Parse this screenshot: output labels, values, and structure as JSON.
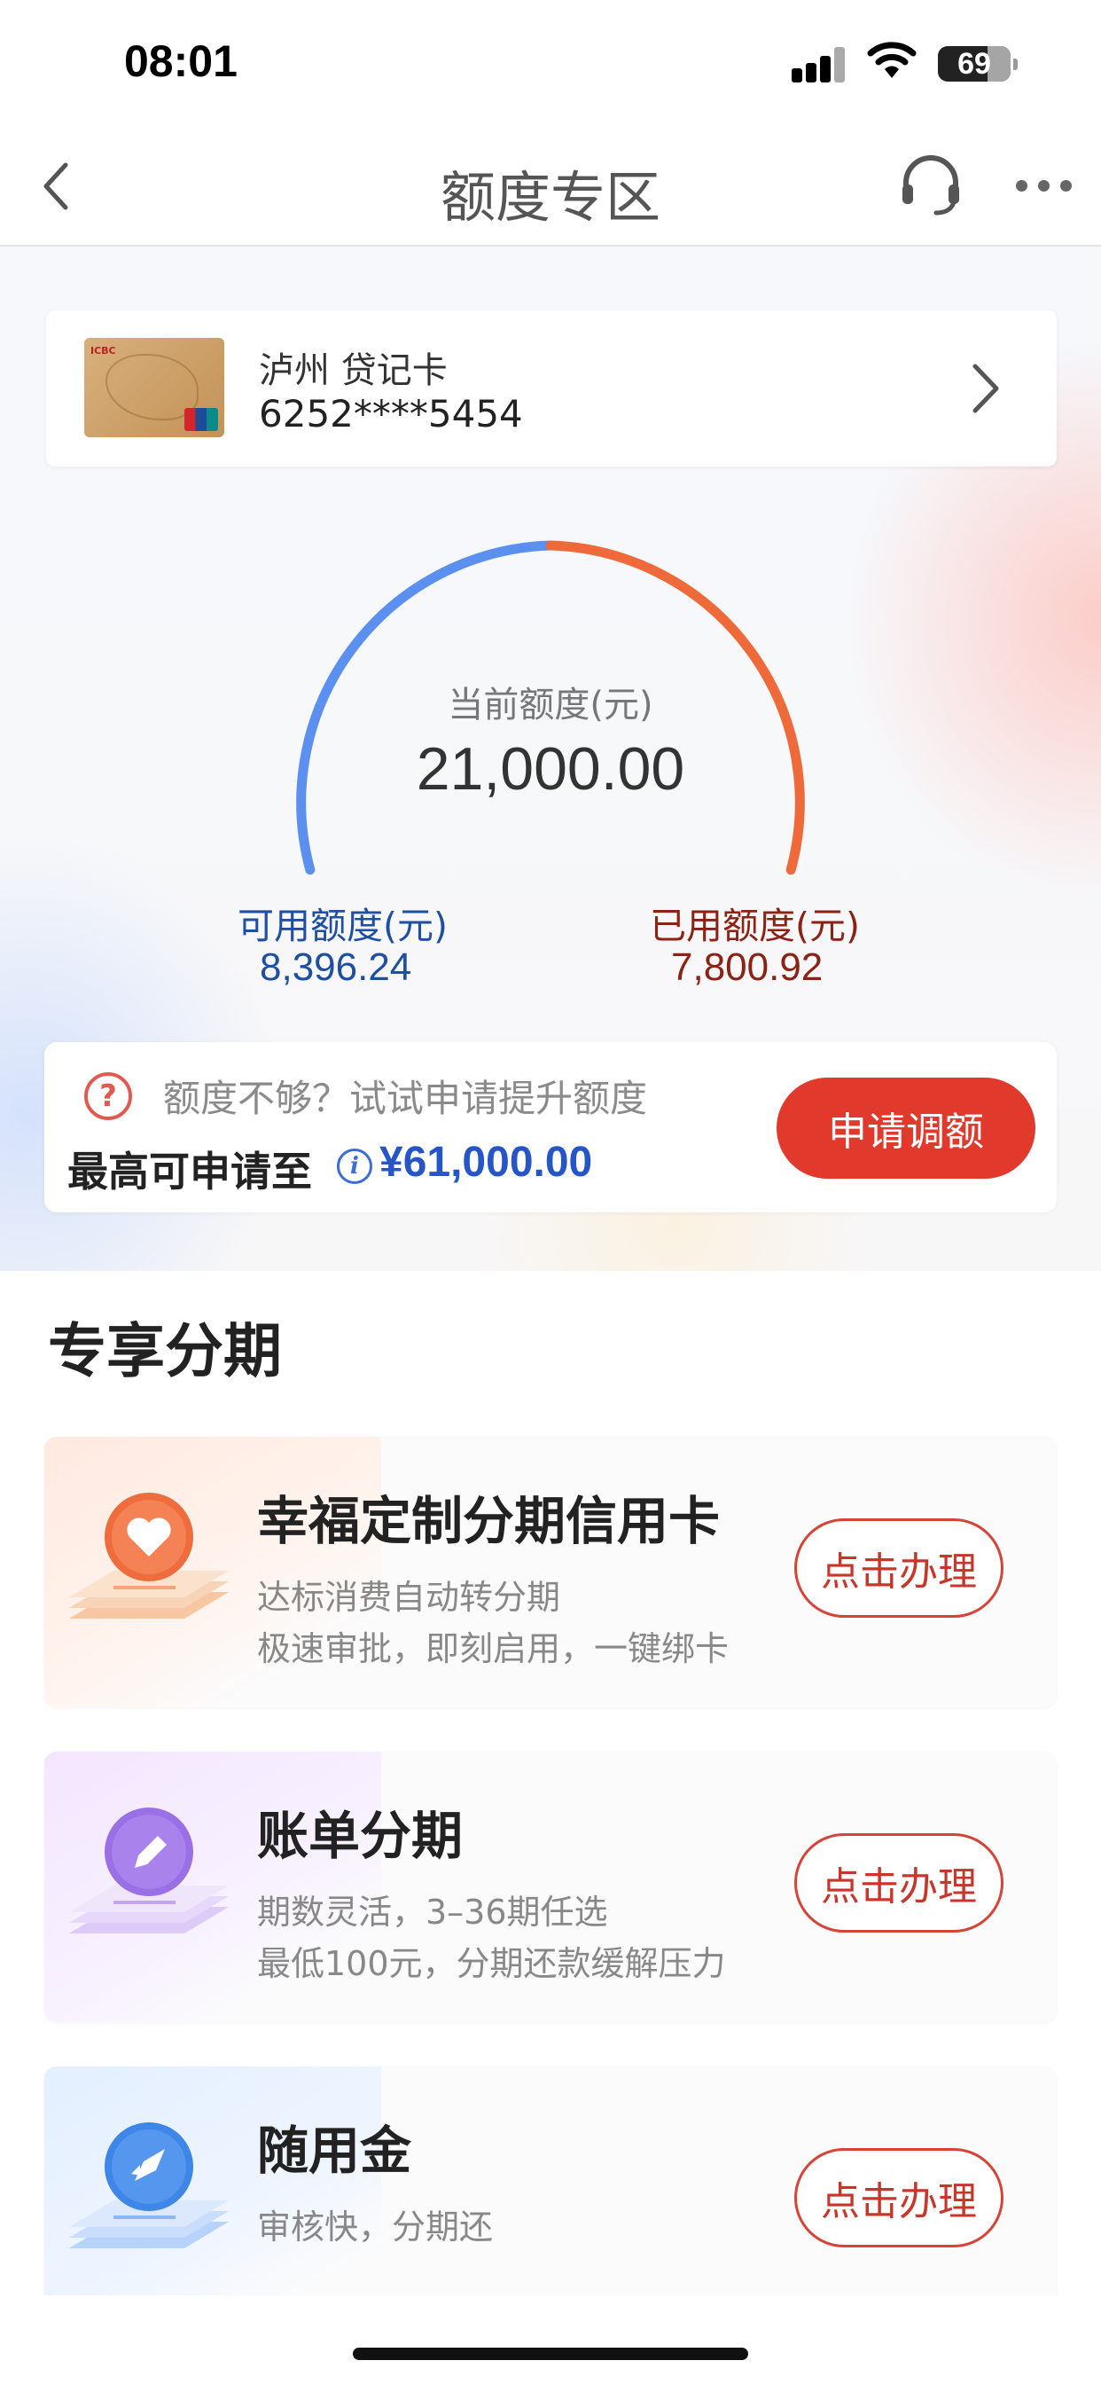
{
  "status_bar": {
    "time": "08:01",
    "battery": "69"
  },
  "nav": {
    "title": "额度专区",
    "icons": [
      "chevron-left-icon",
      "headset-icon",
      "more-icon"
    ]
  },
  "card": {
    "name": "泸州 贷记卡",
    "number": "6252****5454"
  },
  "limit_gauge": {
    "caption": "当前额度(元)",
    "current": "21,000.00",
    "available_label": "可用额度(元)",
    "available_value": "8,396.24",
    "used_label": "已用额度(元)",
    "used_value": "7,800.92",
    "colors": {
      "available": "#5b8ff0",
      "used": "#ee6a3a"
    }
  },
  "limit_upgrade": {
    "tip": "额度不够？试试申请提升额度",
    "label": "最高可申请至",
    "amount": "¥61,000.00",
    "button": "申请调额"
  },
  "section": {
    "title": "专享分期"
  },
  "products": [
    {
      "title": "幸福定制分期信用卡",
      "line1": "达标消费自动转分期",
      "line2": "极速审批，即刻启用，一键绑卡",
      "button": "点击办理",
      "icon": "heart-icon"
    },
    {
      "title": "账单分期",
      "line1": "期数灵活，3–36期任选",
      "line2": "最低100元，分期还款缓解压力",
      "button": "点击办理",
      "icon": "pencil-icon"
    },
    {
      "title": "随用金",
      "line1": "审核快，分期还",
      "button": "点击办理",
      "icon": "rocket-icon"
    }
  ],
  "theme": {
    "accent_red": "#e13a2c",
    "accent_blue": "#2555c7"
  }
}
